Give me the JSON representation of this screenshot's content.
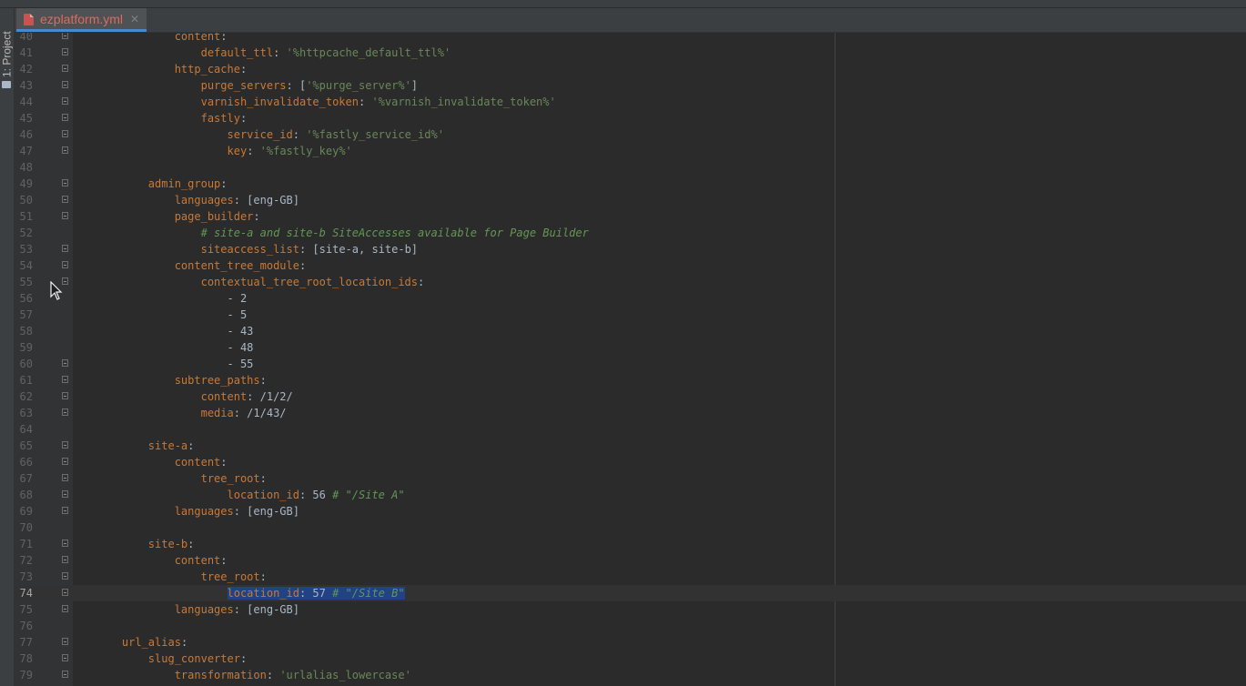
{
  "tab": {
    "filename": "ezplatform.yml",
    "close": "✕"
  },
  "sidebar": {
    "project_label": "1: Project"
  },
  "editor": {
    "current_line": "74",
    "lines": [
      {
        "n": "40",
        "fold": true,
        "segs": [
          {
            "t": "            "
          },
          {
            "t": "content",
            "c": "key"
          },
          {
            "t": ":",
            "c": "plain"
          }
        ]
      },
      {
        "n": "41",
        "fold": true,
        "segs": [
          {
            "t": "                "
          },
          {
            "t": "default_ttl",
            "c": "key"
          },
          {
            "t": ": ",
            "c": "plain"
          },
          {
            "t": "'%httpcache_default_ttl%'",
            "c": "str"
          }
        ]
      },
      {
        "n": "42",
        "fold": true,
        "segs": [
          {
            "t": "            "
          },
          {
            "t": "http_cache",
            "c": "key"
          },
          {
            "t": ":",
            "c": "plain"
          }
        ]
      },
      {
        "n": "43",
        "fold": true,
        "segs": [
          {
            "t": "                "
          },
          {
            "t": "purge_servers",
            "c": "key"
          },
          {
            "t": ": [",
            "c": "plain"
          },
          {
            "t": "'%purge_server%'",
            "c": "str"
          },
          {
            "t": "]",
            "c": "plain"
          }
        ]
      },
      {
        "n": "44",
        "fold": true,
        "segs": [
          {
            "t": "                "
          },
          {
            "t": "varnish_invalidate_token",
            "c": "key"
          },
          {
            "t": ": ",
            "c": "plain"
          },
          {
            "t": "'%varnish_invalidate_token%'",
            "c": "str"
          }
        ]
      },
      {
        "n": "45",
        "fold": true,
        "segs": [
          {
            "t": "                "
          },
          {
            "t": "fastly",
            "c": "key"
          },
          {
            "t": ":",
            "c": "plain"
          }
        ]
      },
      {
        "n": "46",
        "fold": true,
        "segs": [
          {
            "t": "                    "
          },
          {
            "t": "service_id",
            "c": "key"
          },
          {
            "t": ": ",
            "c": "plain"
          },
          {
            "t": "'%fastly_service_id%'",
            "c": "str"
          }
        ]
      },
      {
        "n": "47",
        "fold": true,
        "segs": [
          {
            "t": "                    "
          },
          {
            "t": "key",
            "c": "key"
          },
          {
            "t": ": ",
            "c": "plain"
          },
          {
            "t": "'%fastly_key%'",
            "c": "str"
          }
        ]
      },
      {
        "n": "48",
        "fold": false,
        "segs": []
      },
      {
        "n": "49",
        "fold": true,
        "segs": [
          {
            "t": "        "
          },
          {
            "t": "admin_group",
            "c": "key"
          },
          {
            "t": ":",
            "c": "plain"
          }
        ]
      },
      {
        "n": "50",
        "fold": true,
        "segs": [
          {
            "t": "            "
          },
          {
            "t": "languages",
            "c": "key"
          },
          {
            "t": ": [eng-GB]",
            "c": "plain"
          }
        ]
      },
      {
        "n": "51",
        "fold": true,
        "segs": [
          {
            "t": "            "
          },
          {
            "t": "page_builder",
            "c": "key"
          },
          {
            "t": ":",
            "c": "plain"
          }
        ]
      },
      {
        "n": "52",
        "fold": false,
        "segs": [
          {
            "t": "                "
          },
          {
            "t": "# site-a and site-b SiteAccesses available for Page Builder",
            "c": "cmt"
          }
        ]
      },
      {
        "n": "53",
        "fold": true,
        "segs": [
          {
            "t": "                "
          },
          {
            "t": "siteaccess_list",
            "c": "key"
          },
          {
            "t": ": [site-a, site-b]",
            "c": "plain"
          }
        ]
      },
      {
        "n": "54",
        "fold": true,
        "segs": [
          {
            "t": "            "
          },
          {
            "t": "content_tree_module",
            "c": "key"
          },
          {
            "t": ":",
            "c": "plain"
          }
        ]
      },
      {
        "n": "55",
        "fold": true,
        "segs": [
          {
            "t": "                "
          },
          {
            "t": "contextual_tree_root_location_ids",
            "c": "key"
          },
          {
            "t": ":",
            "c": "plain"
          }
        ]
      },
      {
        "n": "56",
        "fold": false,
        "segs": [
          {
            "t": "                    "
          },
          {
            "t": "- 2",
            "c": "plain"
          }
        ]
      },
      {
        "n": "57",
        "fold": false,
        "segs": [
          {
            "t": "                    "
          },
          {
            "t": "- 5",
            "c": "plain"
          }
        ]
      },
      {
        "n": "58",
        "fold": false,
        "segs": [
          {
            "t": "                    "
          },
          {
            "t": "- 43",
            "c": "plain"
          }
        ]
      },
      {
        "n": "59",
        "fold": false,
        "segs": [
          {
            "t": "                    "
          },
          {
            "t": "- 48",
            "c": "plain"
          }
        ]
      },
      {
        "n": "60",
        "fold": true,
        "segs": [
          {
            "t": "                    "
          },
          {
            "t": "- 55",
            "c": "plain"
          }
        ]
      },
      {
        "n": "61",
        "fold": true,
        "segs": [
          {
            "t": "            "
          },
          {
            "t": "subtree_paths",
            "c": "key"
          },
          {
            "t": ":",
            "c": "plain"
          }
        ]
      },
      {
        "n": "62",
        "fold": true,
        "segs": [
          {
            "t": "                "
          },
          {
            "t": "content",
            "c": "key"
          },
          {
            "t": ": /1/2/",
            "c": "plain"
          }
        ]
      },
      {
        "n": "63",
        "fold": true,
        "segs": [
          {
            "t": "                "
          },
          {
            "t": "media",
            "c": "key"
          },
          {
            "t": ": /1/43/",
            "c": "plain"
          }
        ]
      },
      {
        "n": "64",
        "fold": false,
        "segs": []
      },
      {
        "n": "65",
        "fold": true,
        "segs": [
          {
            "t": "        "
          },
          {
            "t": "site-a",
            "c": "key"
          },
          {
            "t": ":",
            "c": "plain"
          }
        ]
      },
      {
        "n": "66",
        "fold": true,
        "segs": [
          {
            "t": "            "
          },
          {
            "t": "content",
            "c": "key"
          },
          {
            "t": ":",
            "c": "plain"
          }
        ]
      },
      {
        "n": "67",
        "fold": true,
        "segs": [
          {
            "t": "                "
          },
          {
            "t": "tree_root",
            "c": "key"
          },
          {
            "t": ":",
            "c": "plain"
          }
        ]
      },
      {
        "n": "68",
        "fold": true,
        "segs": [
          {
            "t": "                    "
          },
          {
            "t": "location_id",
            "c": "key"
          },
          {
            "t": ": 56 ",
            "c": "plain"
          },
          {
            "t": "# \"/Site A\"",
            "c": "cmt"
          }
        ]
      },
      {
        "n": "69",
        "fold": true,
        "segs": [
          {
            "t": "            "
          },
          {
            "t": "languages",
            "c": "key"
          },
          {
            "t": ": [eng-GB]",
            "c": "plain"
          }
        ]
      },
      {
        "n": "70",
        "fold": false,
        "segs": []
      },
      {
        "n": "71",
        "fold": true,
        "segs": [
          {
            "t": "        "
          },
          {
            "t": "site-b",
            "c": "key"
          },
          {
            "t": ":",
            "c": "plain"
          }
        ]
      },
      {
        "n": "72",
        "fold": true,
        "segs": [
          {
            "t": "            "
          },
          {
            "t": "content",
            "c": "key"
          },
          {
            "t": ":",
            "c": "plain"
          }
        ]
      },
      {
        "n": "73",
        "fold": true,
        "segs": [
          {
            "t": "                "
          },
          {
            "t": "tree_root",
            "c": "key"
          },
          {
            "t": ":",
            "c": "plain"
          }
        ]
      },
      {
        "n": "74",
        "fold": true,
        "segs": [
          {
            "t": "                    "
          },
          {
            "t": "location_id",
            "c": "key sel"
          },
          {
            "t": ": 57 ",
            "c": "plain sel"
          },
          {
            "t": "# \"/Site B\"",
            "c": "cmt sel"
          }
        ]
      },
      {
        "n": "75",
        "fold": true,
        "segs": [
          {
            "t": "            "
          },
          {
            "t": "languages",
            "c": "key"
          },
          {
            "t": ": [eng-GB]",
            "c": "plain"
          }
        ]
      },
      {
        "n": "76",
        "fold": false,
        "segs": []
      },
      {
        "n": "77",
        "fold": true,
        "segs": [
          {
            "t": "    "
          },
          {
            "t": "url_alias",
            "c": "key"
          },
          {
            "t": ":",
            "c": "plain"
          }
        ]
      },
      {
        "n": "78",
        "fold": true,
        "segs": [
          {
            "t": "        "
          },
          {
            "t": "slug_converter",
            "c": "key"
          },
          {
            "t": ":",
            "c": "plain"
          }
        ]
      },
      {
        "n": "79",
        "fold": true,
        "segs": [
          {
            "t": "            "
          },
          {
            "t": "transformation",
            "c": "key"
          },
          {
            "t": ": ",
            "c": "plain"
          },
          {
            "t": "'urlalias_lowercase'",
            "c": "str"
          }
        ]
      }
    ]
  }
}
